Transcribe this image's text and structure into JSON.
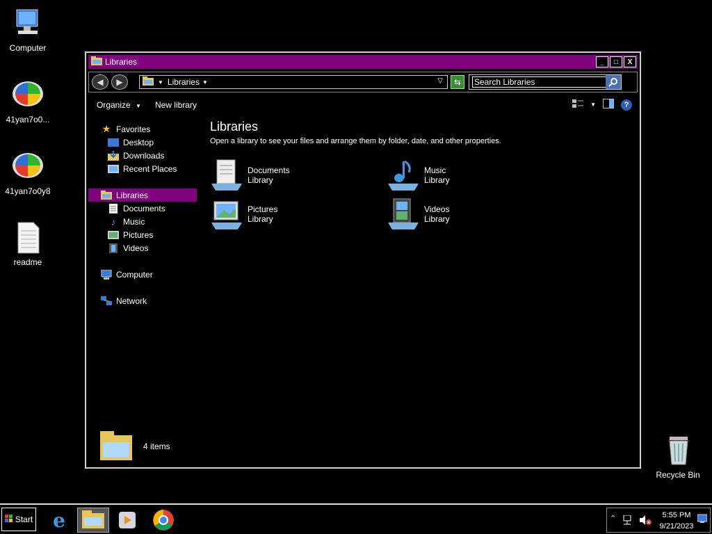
{
  "desktop": {
    "icons": [
      {
        "label": "Computer"
      },
      {
        "label": "41yan7o0..."
      },
      {
        "label": "41yan7o0y8"
      },
      {
        "label": "readme"
      },
      {
        "label": "Recycle Bin"
      }
    ]
  },
  "window": {
    "title": "Libraries",
    "controls": {
      "minimize": "_",
      "maximize": "□",
      "close": "X"
    },
    "address": {
      "crumb": "Libraries"
    },
    "search": {
      "placeholder": "Search Libraries",
      "value": "Search Libraries"
    },
    "toolbar": {
      "organize": "Organize",
      "new_library": "New library",
      "help": "?"
    },
    "navpane": {
      "favorites": "Favorites",
      "desktop": "Desktop",
      "downloads": "Downloads",
      "recent": "Recent Places",
      "libraries": "Libraries",
      "documents": "Documents",
      "music": "Music",
      "pictures": "Pictures",
      "videos": "Videos",
      "computer": "Computer",
      "network": "Network"
    },
    "content": {
      "heading": "Libraries",
      "description": "Open a library to see your files and arrange them by folder, date, and other properties.",
      "libraries": [
        {
          "name": "Documents",
          "type": "Library"
        },
        {
          "name": "Music",
          "type": "Library"
        },
        {
          "name": "Pictures",
          "type": "Library"
        },
        {
          "name": "Videos",
          "type": "Library"
        }
      ]
    },
    "status": {
      "count": "4 items"
    }
  },
  "taskbar": {
    "start": "Start",
    "time": "5:55 PM",
    "date": "9/21/2023"
  },
  "colors": {
    "accent": "#800080",
    "background": "#000000"
  }
}
